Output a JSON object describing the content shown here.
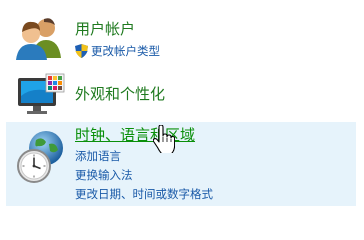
{
  "control_panel": {
    "categories": [
      {
        "heading": "用户帐户",
        "icon": "users-icon",
        "links": [
          {
            "label": "更改帐户类型",
            "icon": "uac-shield-icon"
          }
        ]
      },
      {
        "heading": "外观和个性化",
        "icon": "appearance-icon",
        "links": []
      },
      {
        "heading": "时钟、语言和区域",
        "icon": "clock-globe-icon",
        "hovered": true,
        "links": [
          {
            "label": "添加语言"
          },
          {
            "label": "更换输入法"
          },
          {
            "label": "更改日期、时间或数字格式"
          }
        ]
      }
    ]
  },
  "colors": {
    "heading": "#1f7a1f",
    "link": "#1a5aa8",
    "hover_background": "#e6f3fb"
  },
  "cursor": "hand-pointer-icon"
}
